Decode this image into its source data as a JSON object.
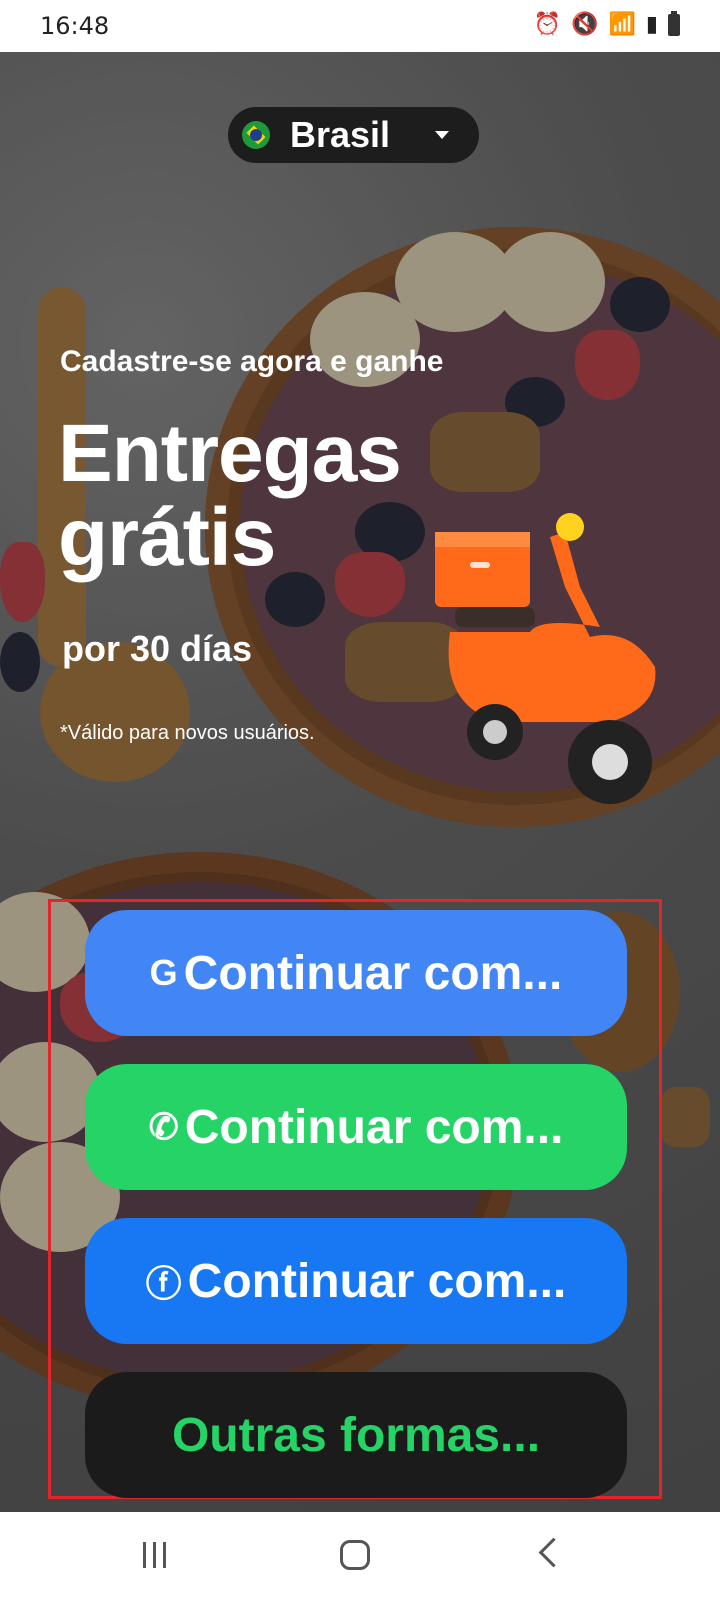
{
  "status_bar": {
    "time": "16:48",
    "icons": [
      "alarm-icon",
      "mute-icon",
      "wifi-icon",
      "signal-icon",
      "battery-icon"
    ]
  },
  "country": {
    "name": "Brasil",
    "flag": "brazil-flag-icon"
  },
  "promo": {
    "subtitle": "Cadastre-se agora e ganhe",
    "title_line1": "Entregas",
    "title_line2": "grátis",
    "duration": "por 30 días",
    "note": "*Válido para novos usuários."
  },
  "actions": {
    "google": {
      "label": "Continuar com...",
      "icon": "google-icon",
      "color": "#4285f4"
    },
    "whatsapp": {
      "label": "Continuar com...",
      "icon": "whatsapp-icon",
      "color": "#25d366"
    },
    "facebook": {
      "label": "Continuar com...",
      "icon": "facebook-icon",
      "color": "#1877f2"
    },
    "other": {
      "label": "Outras formas...",
      "color": "#1b1b1b",
      "text_color": "#25d366"
    }
  },
  "nav": {
    "icons": [
      "recents-icon",
      "home-icon",
      "back-icon"
    ]
  }
}
